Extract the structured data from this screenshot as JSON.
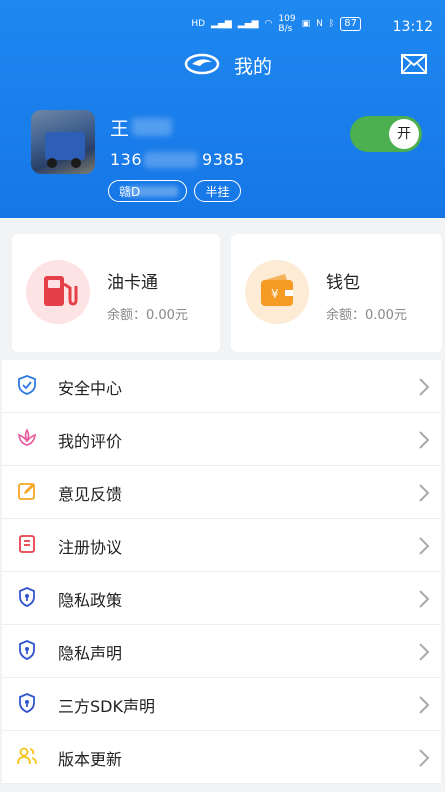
{
  "status": {
    "network1": "HD",
    "network2": "HD",
    "speed": "109\nB/s",
    "battery": "87",
    "time": "13:12"
  },
  "header": {
    "title": "我的"
  },
  "profile": {
    "name": "王",
    "phone_prefix": "136",
    "phone_suffix": "9385",
    "plate": "赣D",
    "vehicle_type": "半挂",
    "toggle_label": "开"
  },
  "cards": {
    "fuel": {
      "title": "油卡通",
      "balance": "余额：0.00元"
    },
    "wallet": {
      "title": "钱包",
      "balance": "余额：0.00元"
    }
  },
  "menu": {
    "items": [
      {
        "label": "安全中心",
        "icon": "shield-check-icon",
        "color": "#2f7be6"
      },
      {
        "label": "我的评价",
        "icon": "lotus-icon",
        "color": "#e85a9b"
      },
      {
        "label": "意见反馈",
        "icon": "edit-icon",
        "color": "#f5a623"
      },
      {
        "label": "注册协议",
        "icon": "document-icon",
        "color": "#e5404a"
      },
      {
        "label": "隐私政策",
        "icon": "shield-lock-icon",
        "color": "#3355cc"
      },
      {
        "label": "隐私声明",
        "icon": "shield-lock-icon",
        "color": "#3355cc"
      },
      {
        "label": "三方SDK声明",
        "icon": "shield-lock-icon",
        "color": "#3355cc"
      },
      {
        "label": "版本更新",
        "icon": "users-icon",
        "color": "#f5c518"
      }
    ]
  },
  "colors": {
    "header_blue": "#1676e6",
    "toggle_green": "#4caf50",
    "fuel_red": "#e5404a",
    "wallet_orange": "#f59a23"
  }
}
